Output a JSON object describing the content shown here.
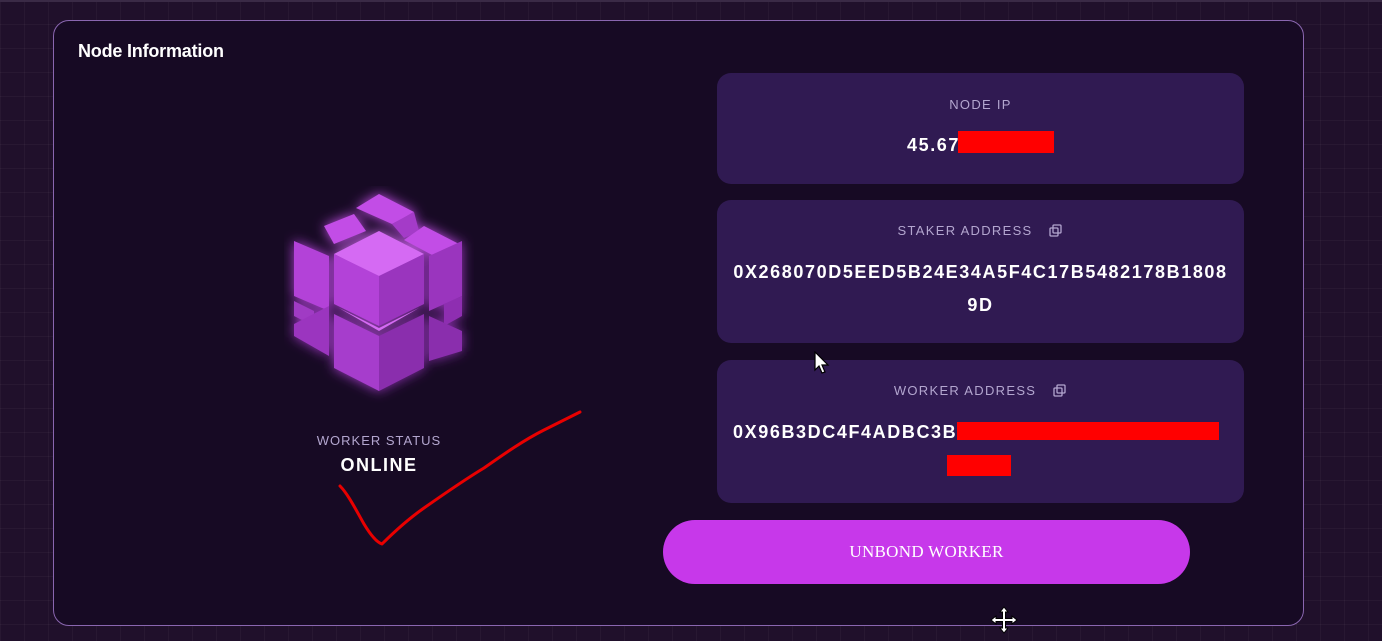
{
  "panel": {
    "title": "Node Information"
  },
  "worker_status": {
    "label": "WORKER STATUS",
    "value": "ONLINE"
  },
  "node_ip": {
    "label": "NODE IP",
    "value_visible": "45.67"
  },
  "staker_address": {
    "label": "STAKER ADDRESS",
    "value": "0X268070D5EED5B24E34A5F4C17B5482178B18089D",
    "copy_icon": "copy-icon"
  },
  "worker_address": {
    "label": "WORKER ADDRESS",
    "value_visible": "0X96B3DC4F4ADBC3B",
    "copy_icon": "copy-icon"
  },
  "actions": {
    "unbond_label": "UNBOND WORKER"
  },
  "colors": {
    "panel_bg": "#170a24",
    "card_bg": "#301a52",
    "accent": "#c738ea",
    "redaction": "#ff0000"
  }
}
